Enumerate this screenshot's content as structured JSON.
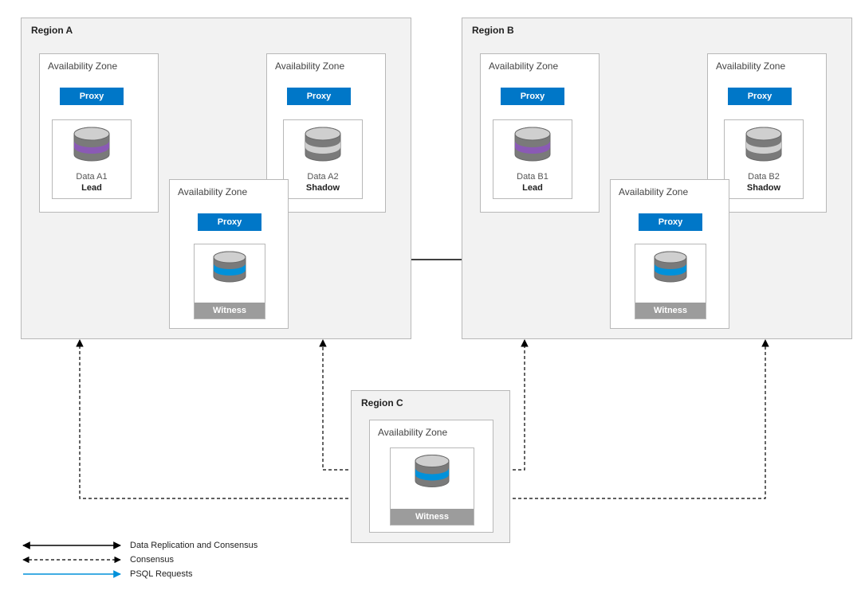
{
  "regions": {
    "a": {
      "title": "Region A"
    },
    "b": {
      "title": "Region B"
    },
    "c": {
      "title": "Region C"
    }
  },
  "labels": {
    "az": "Availability Zone",
    "proxy": "Proxy",
    "witness": "Witness"
  },
  "nodes": {
    "a1": {
      "name": "Data A1",
      "role": "Lead"
    },
    "a2": {
      "name": "Data A2",
      "role": "Shadow"
    },
    "b1": {
      "name": "Data B1",
      "role": "Lead"
    },
    "b2": {
      "name": "Data B2",
      "role": "Shadow"
    }
  },
  "legend": {
    "repl": "Data Replication and Consensus",
    "cons": "Consensus",
    "psql": "PSQL Requests"
  },
  "colors": {
    "proxy": "#0077c8",
    "psql": "#0091da",
    "lead_stripe": "#8a5ab5",
    "witness_stripe": "#0091da",
    "cyl_top": "#b9b9b9",
    "cyl_body": "#7a7a7a"
  }
}
